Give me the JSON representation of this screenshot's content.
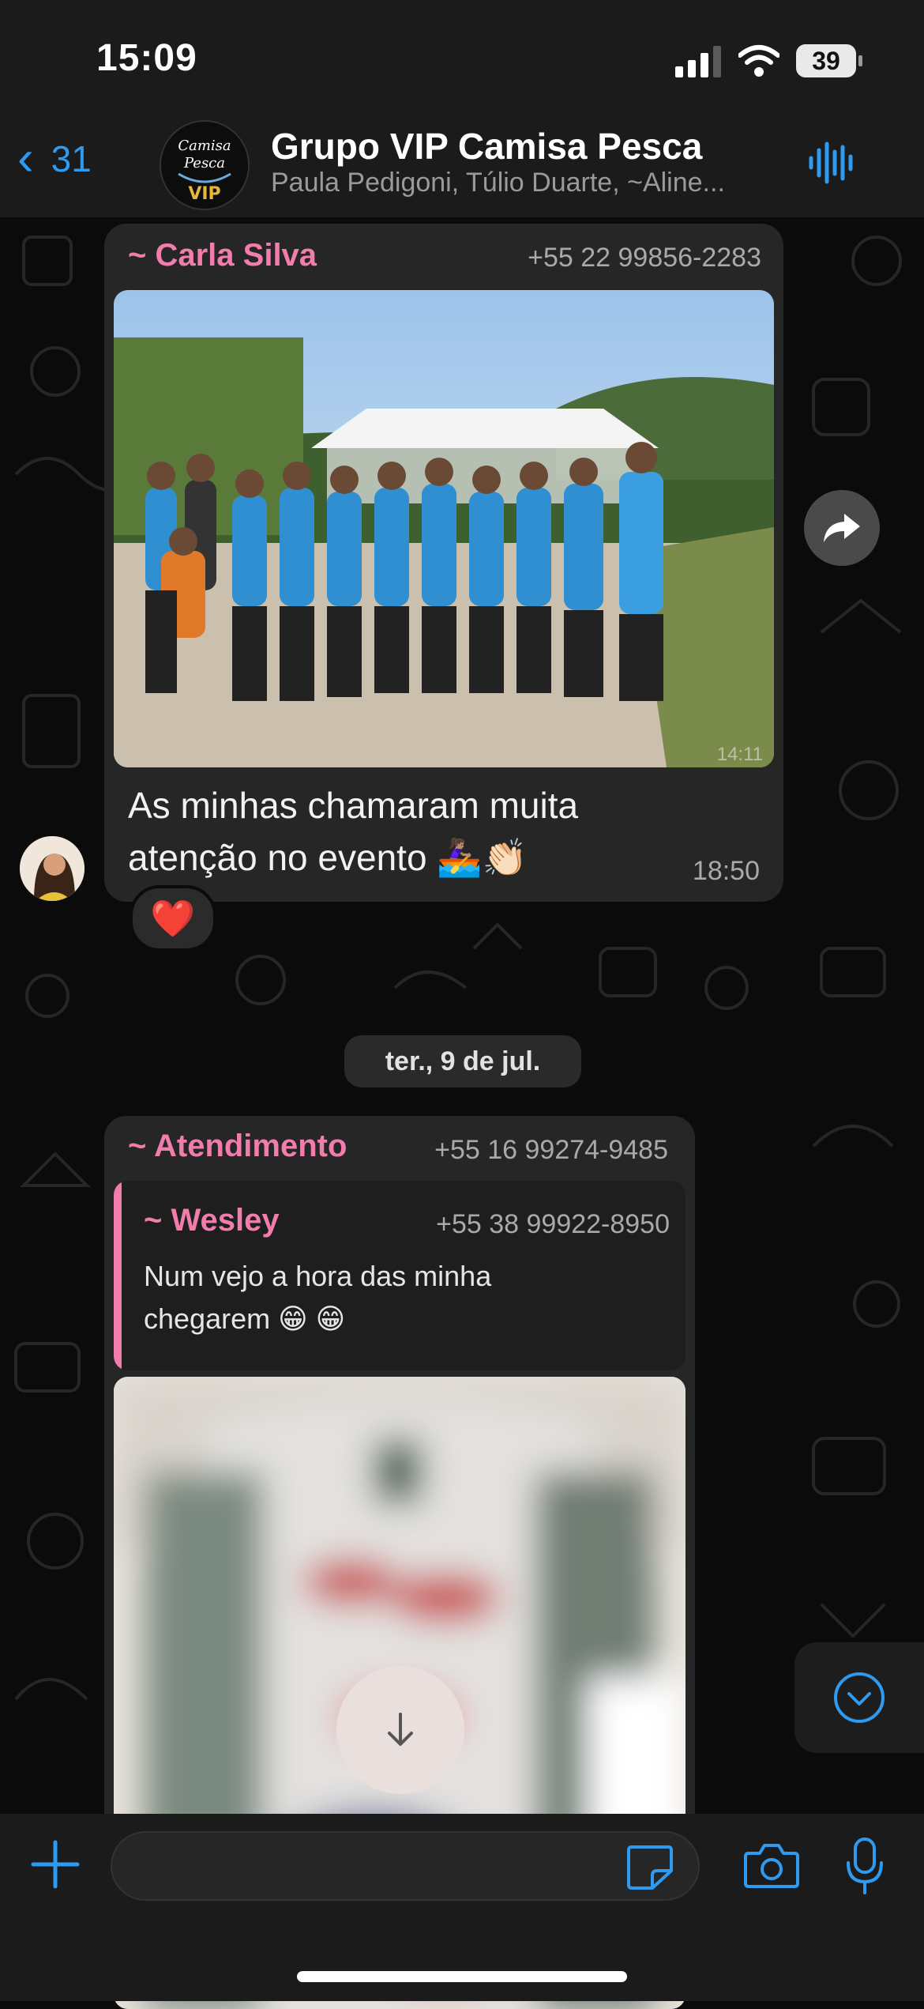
{
  "status_bar": {
    "time": "15:09",
    "battery": "39"
  },
  "header": {
    "back_count": "31",
    "group_avatar_lines": [
      "Camisa",
      "Pesca",
      "VIP"
    ],
    "title": "Grupo VIP Camisa Pesca",
    "subtitle": "Paula Pedigoni, Túlio Duarte, ~Aline..."
  },
  "messages": [
    {
      "sender": "~ Carla Silva",
      "phone": "+55 22 99856-2283",
      "photo_time": "14:11",
      "text_line1": "As minhas chamaram muita",
      "text_line2": "atenção no evento 🚣🏽‍♀️👏🏻",
      "time": "18:50",
      "reaction": "❤️"
    },
    {
      "sender": "~ Atendimento",
      "phone": "+55 16 99274-9485",
      "quote": {
        "sender": "~ Wesley",
        "phone": "+55 38 99922-8950",
        "text_line1": "Num vejo a hora das minha",
        "text_line2": "chegarem 😁 😁"
      }
    }
  ],
  "date_separator": "ter., 9 de jul.",
  "colors": {
    "accent": "#2e9bf0",
    "sender_name": "#f07dac",
    "bubble": "#262626"
  },
  "icons": [
    "back-chevron-icon",
    "voice-call-icon",
    "forward-icon",
    "download-icon",
    "scroll-down-icon",
    "plus-icon",
    "sticker-icon",
    "camera-icon",
    "mic-icon"
  ]
}
